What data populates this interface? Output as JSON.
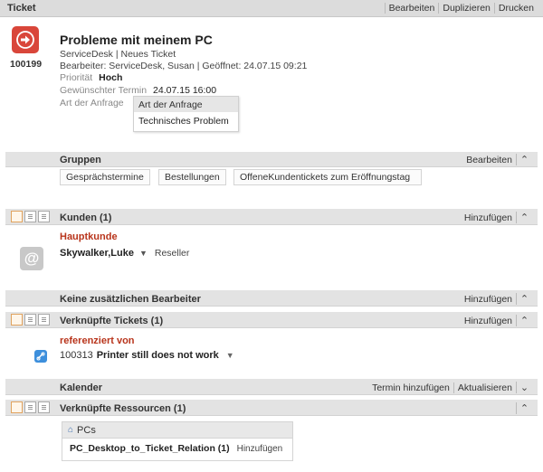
{
  "header": {
    "title": "Ticket",
    "actions": [
      "Bearbeiten",
      "Duplizieren",
      "Drucken"
    ]
  },
  "ticket": {
    "number": "100199",
    "subject": "Probleme mit meinem PC",
    "meta1": "ServiceDesk | Neues Ticket",
    "meta2": "Bearbeiter: ServiceDesk, Susan | Geöffnet: 24.07.15 09:21",
    "priority_label": "Priorität",
    "priority_value": "Hoch",
    "due_label": "Gewünschter Termin",
    "due_value": "24.07.15 16:00",
    "request_label": "Art der Anfrage",
    "dropdown": {
      "header": "Art der Anfrage",
      "option": "Technisches Problem"
    }
  },
  "groups": {
    "title": "Gruppen",
    "action": "Bearbeiten",
    "chips": [
      "Gesprächstermine",
      "Bestellungen",
      "OffeneKundentickets zum Eröffnungstag"
    ]
  },
  "customers": {
    "title": "Kunden (1)",
    "action": "Hinzufügen",
    "sub_label": "Hauptkunde",
    "name": "Skywalker,Luke",
    "role": "Reseller"
  },
  "editors": {
    "title": "Keine zusätzlichen Bearbeiter",
    "action": "Hinzufügen"
  },
  "linked_tickets": {
    "title": "Verknüpfte Tickets (1)",
    "action": "Hinzufügen",
    "sub_label": "referenziert von",
    "number": "100313",
    "name": "Printer still does not work"
  },
  "calendar": {
    "title": "Kalender",
    "actions": [
      "Termin hinzufügen",
      "Aktualisieren"
    ]
  },
  "resources": {
    "title": "Verknüpfte Ressourcen (1)",
    "group": "PCs",
    "item": "PC_Desktop_to_Ticket_Relation (1)",
    "add": "Hinzufügen"
  },
  "colors": {
    "accent_red": "#c0392b",
    "icon_blue": "#3d8fdc",
    "bar_gray": "#e3e3e3"
  }
}
